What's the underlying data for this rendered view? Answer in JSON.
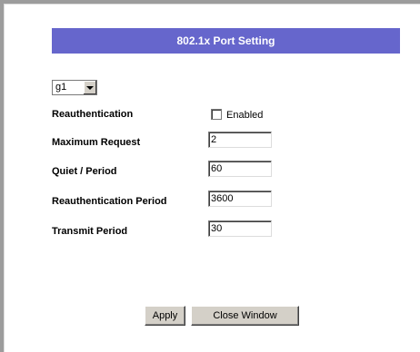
{
  "page": {
    "title": "802.1x Port Setting"
  },
  "port": {
    "selected": "g1"
  },
  "settings": {
    "reauthentication": {
      "label": "Reauthentication",
      "checkbox_label": "Enabled",
      "checked": false
    },
    "maximum_request": {
      "label": "Maximum Request",
      "value": "2"
    },
    "quiet_period": {
      "label": "Quiet / Period",
      "value": "60"
    },
    "reauthentication_period": {
      "label": "Reauthentication Period",
      "value": "3600"
    },
    "transmit_period": {
      "label": "Transmit Period",
      "value": "30"
    }
  },
  "buttons": {
    "apply": "Apply",
    "close_window": "Close Window"
  }
}
